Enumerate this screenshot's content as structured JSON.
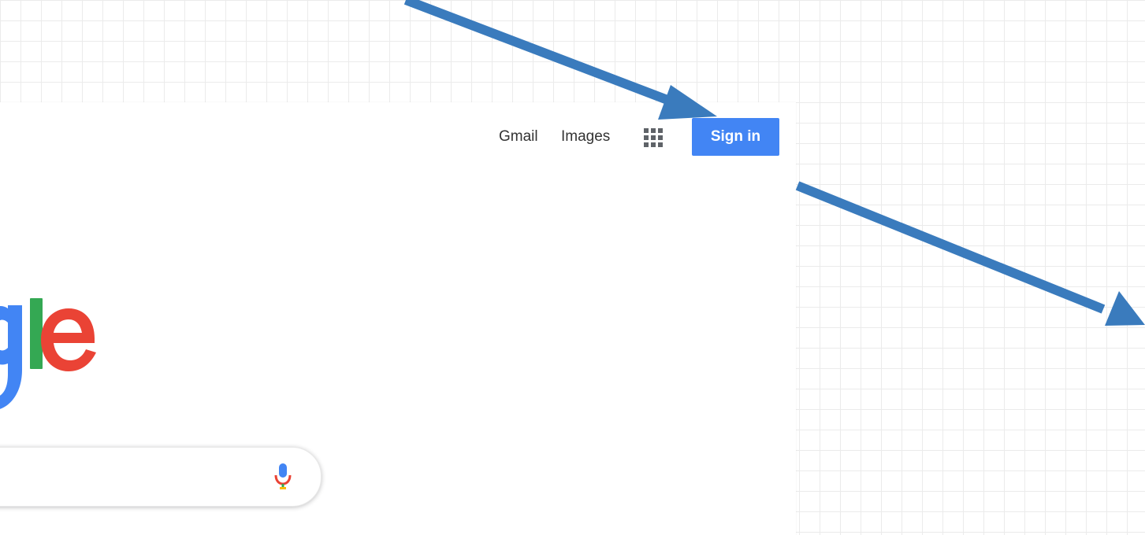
{
  "nav": {
    "gmail_label": "Gmail",
    "images_label": "Images",
    "apps_icon": "apps-grid-icon",
    "signin_label": "Sign in"
  },
  "logo": {
    "visible_text": "gle",
    "letter_colors": {
      "g": "#4285f4",
      "l": "#34a853",
      "e": "#ea4335"
    }
  },
  "search": {
    "mic_icon": "microphone-icon",
    "mic_colors": {
      "top": "#4285f4",
      "middle": "#ea4335",
      "stem": "#34a853",
      "base": "#fbbc05"
    }
  },
  "annotations": {
    "arrow_color": "#3a7bbd",
    "arrow_count": 2
  },
  "colors": {
    "signin_bg": "#4285f4",
    "signin_text": "#ffffff",
    "nav_text": "#333333",
    "grid_line": "#ebebeb"
  }
}
